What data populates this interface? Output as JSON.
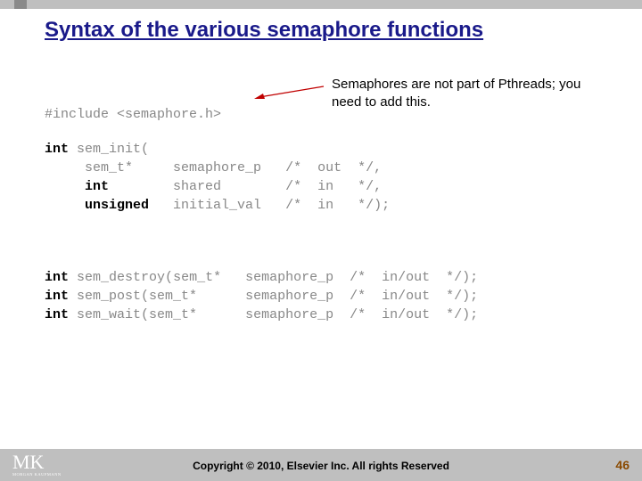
{
  "title": "Syntax of the various semaphore functions",
  "callout": "Semaphores are not part of Pthreads; you need to add this.",
  "code": {
    "include_hash": "#include",
    "include_file": "<semaphore.h>",
    "sem_init": {
      "ret": "int",
      "name": "sem_init(",
      "p1_type": "sem_t*",
      "p1_name": "semaphore_p",
      "p1_c": "/*  out  */,",
      "p2_type": "int",
      "p2_name": "shared",
      "p2_c": "/*  in   */,",
      "p3_type": "unsigned",
      "p3_name": "initial_val",
      "p3_c": "/*  in   */);"
    },
    "fns": [
      {
        "ret": "int",
        "name": "sem_destroy(",
        "t": "sem_t*",
        "arg": "semaphore_p",
        "c": "/*  in/out  */);"
      },
      {
        "ret": "int",
        "name": "sem_post(",
        "t": "sem_t*",
        "arg": "semaphore_p",
        "c": "/*  in/out  */);"
      },
      {
        "ret": "int",
        "name": "sem_wait(",
        "t": "sem_t*",
        "arg": "semaphore_p",
        "c": "/*  in/out  */);"
      }
    ]
  },
  "logo": {
    "main": "MK",
    "sub": "MORGAN KAUFMANN"
  },
  "copyright": "Copyright © 2010, Elsevier Inc. All rights Reserved",
  "page": "46"
}
